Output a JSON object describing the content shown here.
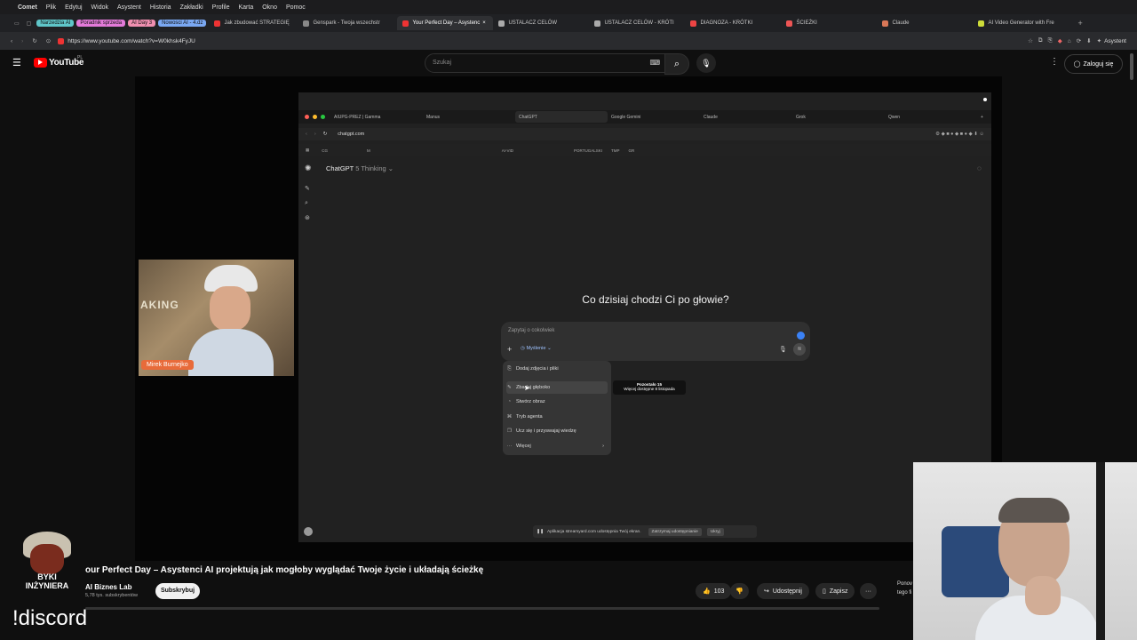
{
  "menubar": {
    "app": "Comet",
    "items": [
      "Plik",
      "Edytuj",
      "Widok",
      "Asystent",
      "Historia",
      "Zakładki",
      "Profile",
      "Karta",
      "Okno",
      "Pomoc"
    ]
  },
  "tabstrip": {
    "chips": [
      {
        "label": "Narzedzia AI",
        "color": "#5fc6c9"
      },
      {
        "label": "Poradnik sprzeda",
        "color": "#e37ad9"
      },
      {
        "label": "AI Day 3",
        "color": "#f08fb0"
      },
      {
        "label": "Nowosci AI - 4.dz",
        "color": "#7aa8f2"
      }
    ],
    "tabs": [
      {
        "label": "Jak zbudować STRATEGIĘ",
        "icon": "#e33"
      },
      {
        "label": "Genspark - Twoja wszechstr",
        "icon": "#888"
      },
      {
        "label": "Your Perfect Day – Asystenc",
        "icon": "#e33",
        "active": true
      },
      {
        "label": "USTALACZ CELÓW",
        "icon": "#aaa"
      },
      {
        "label": "USTALACZ CELÓW - KRÓTI",
        "icon": "#aaa"
      },
      {
        "label": "DIAGNOZA - KRÓTKI",
        "icon": "#e44"
      },
      {
        "label": "ŚCIEŻKI",
        "icon": "#e55"
      },
      {
        "label": "Claude",
        "icon": "#d97757"
      },
      {
        "label": "AI Video Generator with Fre",
        "icon": "#cddc39"
      }
    ],
    "new_tab": "+"
  },
  "address": {
    "url": "https://www.youtube.com/watch?v=W0khsk4FyJU",
    "assistant_label": "Asystent"
  },
  "youtube": {
    "logo_text": "YouTube",
    "logo_sup": "PL",
    "search_placeholder": "Szukaj",
    "signin": "Zaloguj się"
  },
  "inner": {
    "tabs": [
      {
        "label": "AIUPG-PREZ | Gamma"
      },
      {
        "label": "Manus"
      },
      {
        "label": "ChatGPT",
        "active": true
      },
      {
        "label": "Google Gemini"
      },
      {
        "label": "Claude"
      },
      {
        "label": "Grok"
      },
      {
        "label": "Qwen"
      }
    ],
    "url": "chatgpt.com",
    "bookmarks": [
      "CG",
      "M",
      "AI-VID",
      "PORTUGALSKI",
      "TMP",
      "GR"
    ],
    "model": "ChatGPT",
    "model_variant": "5 Thinking",
    "greeting": "Co dzisiaj chodzi Ci po głowie?",
    "input_placeholder": "Zapytaj o cokolwiek",
    "mode": "Myślenie",
    "menu": [
      {
        "label": "Dodaj zdjęcia i pliki",
        "icon": "⎘"
      },
      {
        "label": "Zbadaj głęboko",
        "icon": "✎",
        "highlight": true
      },
      {
        "label": "Stwórz obraz",
        "icon": "◔"
      },
      {
        "label": "Tryb agenta",
        "icon": "⌘"
      },
      {
        "label": "Ucz się i przyswajaj wiedzę",
        "icon": "❐"
      },
      {
        "label": "Więcej",
        "icon": "···",
        "arrow": "›"
      }
    ],
    "tooltip_title": "Pozostało 15",
    "tooltip_sub": "Więcej dostępne 8 listopada",
    "share_msg": "Aplikacja streamyard.com udostępnia Twój ekran.",
    "share_stop": "Zatrzymaj udostępnianie",
    "share_hide": "Ukryj"
  },
  "cam1": {
    "name": "Mirek Burnejko",
    "poster": "AKING"
  },
  "video": {
    "title": "our Perfect Day – Asystenci AI projektują jak mogłoby wyglądać Twoje życie i układają ścieżkę",
    "channel": "AI Biznes Lab",
    "subs": "5,78 tys. subskrybentów",
    "subscribe": "Subskrybuj",
    "likes": "103",
    "share": "Udostępnij",
    "save": "Zapisz",
    "more": "···",
    "side_text_1": "Ponov",
    "side_text_2": "tego fi"
  },
  "logo_text": "BYKI INŻYNIERA",
  "overlay_text": "!discord"
}
